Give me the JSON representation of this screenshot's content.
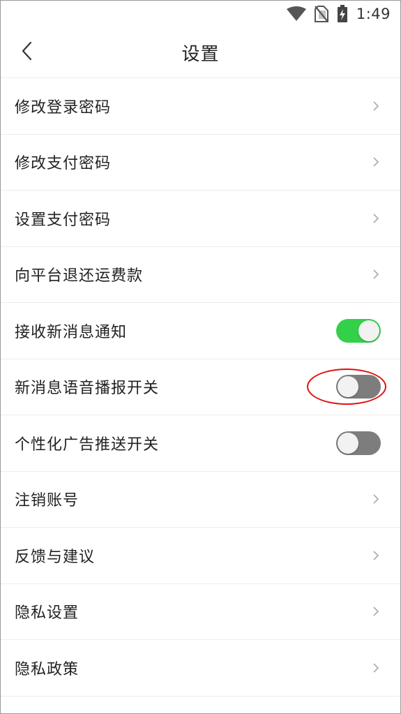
{
  "status_bar": {
    "time": "1:49",
    "icons": [
      "wifi-icon",
      "no-sim-icon",
      "battery-charging-icon"
    ]
  },
  "header": {
    "title": "设置",
    "back_icon": "chevron-left-icon"
  },
  "settings": [
    {
      "label": "修改登录密码",
      "type": "link"
    },
    {
      "label": "修改支付密码",
      "type": "link"
    },
    {
      "label": "设置支付密码",
      "type": "link"
    },
    {
      "label": "向平台退还运费款",
      "type": "link"
    },
    {
      "label": "接收新消息通知",
      "type": "toggle",
      "on": true
    },
    {
      "label": "新消息语音播报开关",
      "type": "toggle",
      "on": false,
      "highlighted": true
    },
    {
      "label": "个性化广告推送开关",
      "type": "toggle",
      "on": false
    },
    {
      "label": "注销账号",
      "type": "link"
    },
    {
      "label": "反馈与建议",
      "type": "link"
    },
    {
      "label": "隐私设置",
      "type": "link"
    },
    {
      "label": "隐私政策",
      "type": "link"
    }
  ],
  "colors": {
    "toggle_on": "#33d14a",
    "toggle_off": "#7d7d7d",
    "highlight": "#e31010"
  }
}
